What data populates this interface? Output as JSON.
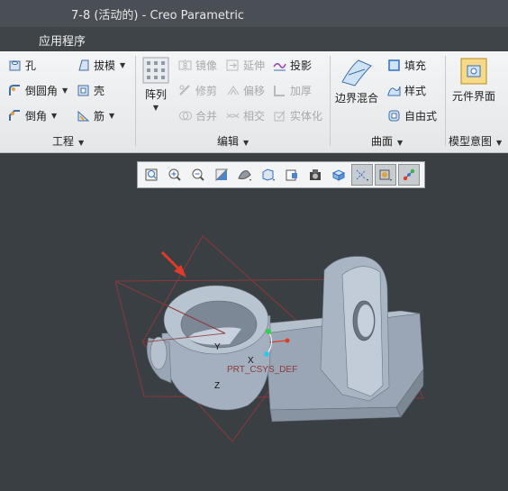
{
  "window": {
    "title": "7-8 (活动的) - Creo Parametric"
  },
  "menu": {
    "app_programs": "应用程序"
  },
  "ribbon": {
    "engineering": {
      "hole": "孔",
      "round": "倒圆角",
      "chamfer": "倒角",
      "draft": "拔模",
      "shell": "壳",
      "rib": "筋",
      "group_label": "工程"
    },
    "editing": {
      "pattern": "阵列",
      "mirror": "镜像",
      "extend": "延伸",
      "project": "投影",
      "trim": "修剪",
      "offset": "偏移",
      "thicken": "加厚",
      "merge": "合并",
      "intersect": "相交",
      "solidify": "实体化",
      "group_label": "编辑"
    },
    "surfaces": {
      "boundary_blend": "边界混合",
      "fill": "填充",
      "style": "样式",
      "freestyle": "自由式",
      "group_label": "曲面"
    },
    "model_intent": {
      "component_interface": "元件界面",
      "group_label": "模型意图"
    }
  },
  "view_toolbar": {
    "buttons": [
      "refit-icon",
      "zoom-in-icon",
      "zoom-out-icon",
      "repaint-icon",
      "display-style-icon",
      "saved-orientations-icon",
      "view-manager-icon",
      "perspective-icon",
      "annotation-display-icon",
      "datum-display-icon",
      "spin-center-icon",
      "csys-display-icon"
    ]
  },
  "model": {
    "csys_label": "PRT_CSYS_DEF",
    "axis_x": "X",
    "axis_y": "Y",
    "axis_z": "Z"
  },
  "colors": {
    "part": "#a6b2c1",
    "datum_plane": "#8a3a3a",
    "annotation_arrow": "#e03a2a"
  }
}
